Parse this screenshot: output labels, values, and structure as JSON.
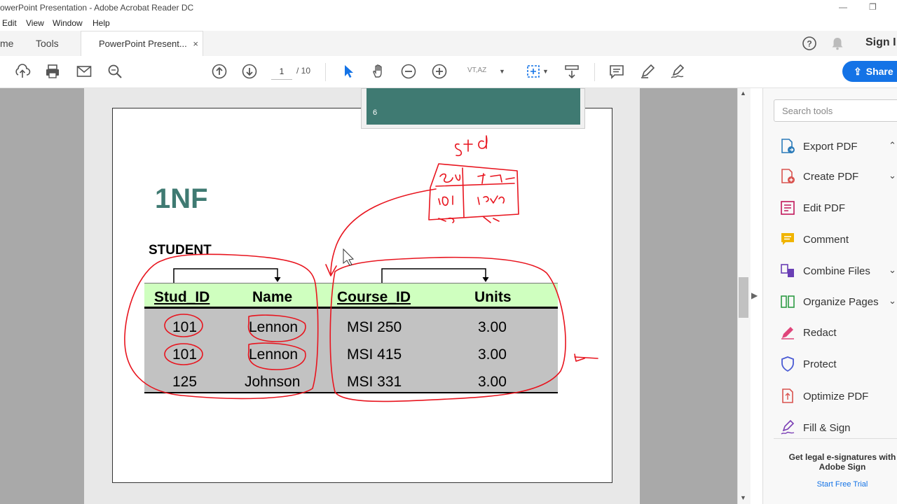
{
  "window": {
    "title": "PowerPoint Presentation - Adobe Acrobat Reader DC"
  },
  "menu": [
    "Edit",
    "View",
    "Window",
    "Help"
  ],
  "tabs": {
    "home": "me",
    "tools": "Tools",
    "document": "PowerPoint Present...",
    "close": "×"
  },
  "header": {
    "sign_in": "Sign I"
  },
  "toolbar": {
    "page_current": "1",
    "page_total": "/ 10",
    "zoom": "VT,AZ",
    "share": "Share"
  },
  "preview": {
    "slide_number": "6"
  },
  "slide": {
    "heading": "1NF",
    "table_name": "STUDENT",
    "columns": [
      "Stud_ID",
      "Name",
      "Course_ID",
      "Units"
    ],
    "rows": [
      [
        "101",
        "Lennon",
        "MSI 250",
        "3.00"
      ],
      [
        "101",
        "Lennon",
        "MSI 415",
        "3.00"
      ],
      [
        "125",
        "Johnson",
        "MSI 331",
        "3.00"
      ]
    ]
  },
  "annotations": {
    "handwriting": "std",
    "color": "#e8141e"
  },
  "right_panel": {
    "search_placeholder": "Search tools",
    "tools": [
      {
        "label": "Export PDF",
        "icon": "export-pdf-icon",
        "chevron": "up"
      },
      {
        "label": "Create PDF",
        "icon": "create-pdf-icon",
        "chevron": "down"
      },
      {
        "label": "Edit PDF",
        "icon": "edit-pdf-icon"
      },
      {
        "label": "Comment",
        "icon": "comment-icon"
      },
      {
        "label": "Combine Files",
        "icon": "combine-files-icon",
        "chevron": "down"
      },
      {
        "label": "Organize Pages",
        "icon": "organize-pages-icon",
        "chevron": "down"
      },
      {
        "label": "Redact",
        "icon": "redact-icon"
      },
      {
        "label": "Protect",
        "icon": "protect-icon"
      },
      {
        "label": "Optimize PDF",
        "icon": "optimize-pdf-icon"
      },
      {
        "label": "Fill & Sign",
        "icon": "fill-sign-icon"
      }
    ],
    "promo_title": "Get legal e-signatures with Adobe Sign",
    "promo_link": "Start Free Trial"
  },
  "colors": {
    "accent": "#1473e6",
    "slide_teal": "#3f7a72",
    "header_green": "#cfffbf",
    "body_gray": "#c2c2c2"
  }
}
